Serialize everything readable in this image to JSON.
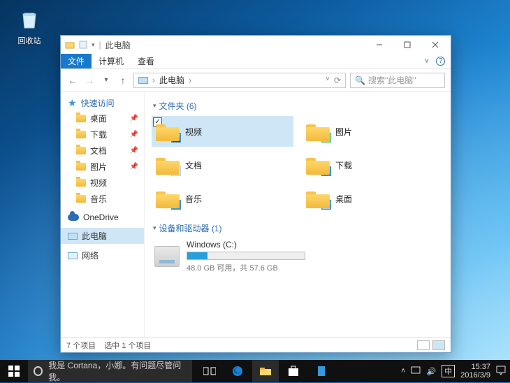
{
  "desktop": {
    "recycle_bin": "回收站"
  },
  "window": {
    "title": "此电脑",
    "tabs": {
      "file": "文件",
      "computer": "计算机",
      "view": "查看"
    },
    "addr": {
      "location": "此电脑",
      "sep": "›",
      "search_placeholder": "搜索\"此电脑\""
    },
    "nav": {
      "quick_access": "快速访问",
      "items": [
        {
          "label": "桌面"
        },
        {
          "label": "下载"
        },
        {
          "label": "文档"
        },
        {
          "label": "图片"
        },
        {
          "label": "视频"
        },
        {
          "label": "音乐"
        }
      ],
      "onedrive": "OneDrive",
      "this_pc": "此电脑",
      "network": "网络"
    },
    "groups": {
      "folders_title": "文件夹 (6)",
      "folders": [
        {
          "label": "视频",
          "kind": "video",
          "selected": true
        },
        {
          "label": "图片",
          "kind": "pictures"
        },
        {
          "label": "文档",
          "kind": "documents"
        },
        {
          "label": "下载",
          "kind": "downloads"
        },
        {
          "label": "音乐",
          "kind": "music"
        },
        {
          "label": "桌面",
          "kind": "desktop"
        }
      ],
      "drives_title": "设备和驱动器 (1)",
      "drives": [
        {
          "name": "Windows (C:)",
          "free": "48.0 GB 可用，共 57.6 GB",
          "pct": 17
        }
      ]
    },
    "status": {
      "count": "7 个项目",
      "selection": "选中 1 个项目"
    }
  },
  "taskbar": {
    "search_placeholder": "我是 Cortana，小娜。有问题尽管问我。",
    "ime": "中",
    "time": "15:37",
    "date": "2016/3/9"
  }
}
